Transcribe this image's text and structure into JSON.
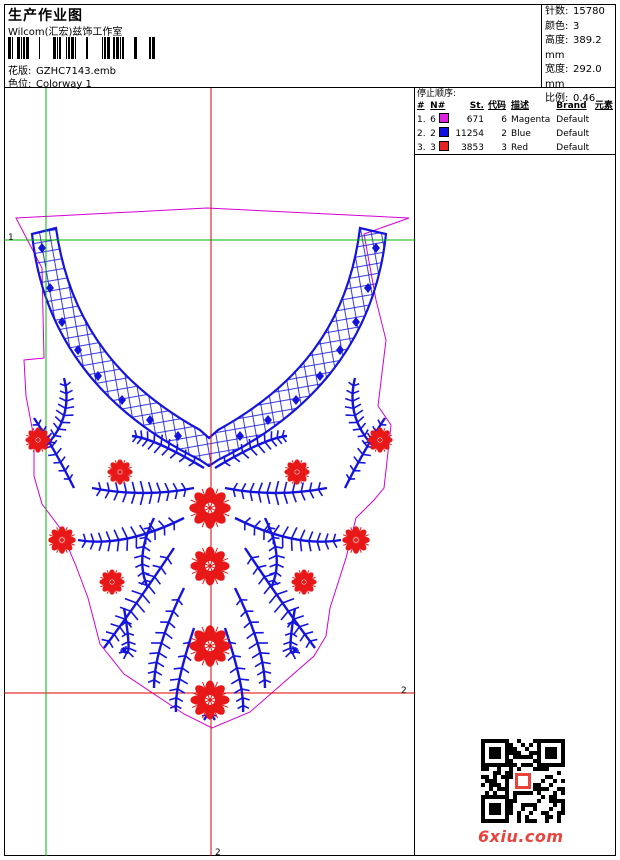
{
  "header": {
    "title": "生产作业图",
    "company": "Wilcom(汇宏)兹饰工作室",
    "design_label": "花版:",
    "design_value": "GZHC7143.emb",
    "colorway_label": "色位:",
    "colorway_value": "Colorway 1"
  },
  "stats": {
    "stitches_label": "针数:",
    "stitches_value": "15780",
    "colors_label": "颜色:",
    "colors_value": "3",
    "height_label": "高度:",
    "height_value": "389.2 mm",
    "width_label": "宽度:",
    "width_value": "292.0 mm",
    "scale_label": "比例:",
    "scale_value": "0.46"
  },
  "stop_sequence": {
    "heading": "停止顺序:",
    "columns": [
      "#",
      "N#",
      "St.",
      "代码",
      "描述",
      "Brand",
      "元素"
    ],
    "rows": [
      {
        "index": "1.",
        "needle": "6",
        "stitches": "671",
        "code": "6",
        "desc": "Magenta",
        "brand": "Default",
        "color": "#e020e0"
      },
      {
        "index": "2.",
        "needle": "2",
        "stitches": "11254",
        "code": "2",
        "desc": "Blue",
        "brand": "Default",
        "color": "#1010e0"
      },
      {
        "index": "3.",
        "needle": "3",
        "stitches": "3853",
        "code": "3",
        "desc": "Red",
        "brand": "Default",
        "color": "#e82020"
      }
    ]
  },
  "guides": {
    "label_1": "1",
    "label_2": "2"
  },
  "colors": {
    "outline": "#d400d4",
    "blue": "#1414dc",
    "red": "#e81818",
    "guide_red": "#e00000",
    "guide_green": "#00b400"
  },
  "watermark": {
    "site": "6xiu.com"
  }
}
